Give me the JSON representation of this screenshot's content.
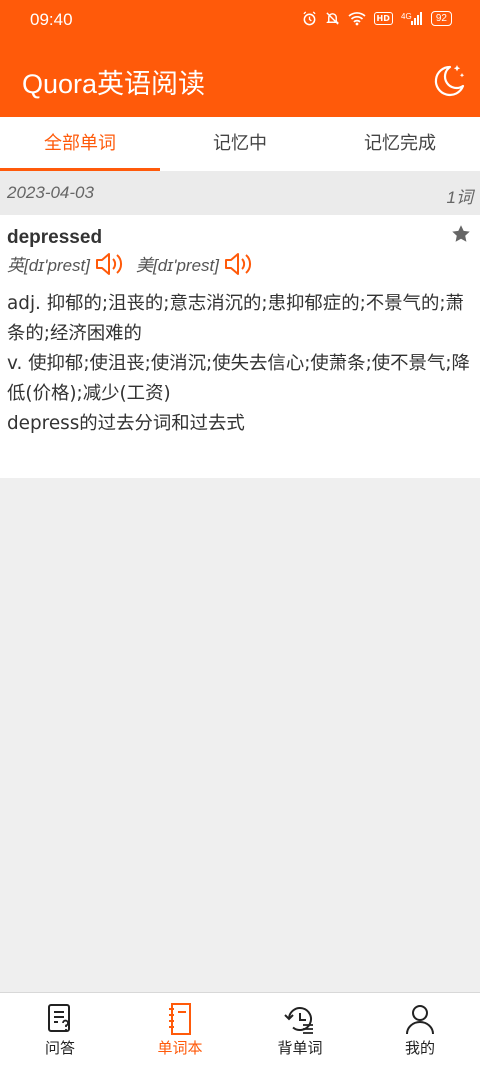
{
  "status_bar": {
    "time": "09:40",
    "battery": "92",
    "network": "4G",
    "hd": "HD"
  },
  "header": {
    "title": "Quora英语阅读"
  },
  "tabs": [
    {
      "label": "全部单词",
      "active": true
    },
    {
      "label": "记忆中",
      "active": false
    },
    {
      "label": "记忆完成",
      "active": false
    }
  ],
  "group": {
    "date": "2023-04-03",
    "count": "1词"
  },
  "entry": {
    "word": "depressed",
    "uk_phonetic": "英[dɪ'prest]",
    "us_phonetic": "美[dɪ'prest]",
    "definitions": [
      "adj. 抑郁的;沮丧的;意志消沉的;患抑郁症的;不景气的;萧条的;经济困难的",
      "v. 使抑郁;使沮丧;使消沉;使失去信心;使萧条;使不景气;降低(价格);减少(工资)",
      "depress的过去分词和过去式"
    ]
  },
  "bottom_nav": [
    {
      "label": "问答",
      "icon": "qa-icon",
      "active": false
    },
    {
      "label": "单词本",
      "icon": "notebook-icon",
      "active": true
    },
    {
      "label": "背单词",
      "icon": "review-icon",
      "active": false
    },
    {
      "label": "我的",
      "icon": "profile-icon",
      "active": false
    }
  ],
  "colors": {
    "accent": "#ff5a0a",
    "background": "#efefef"
  }
}
